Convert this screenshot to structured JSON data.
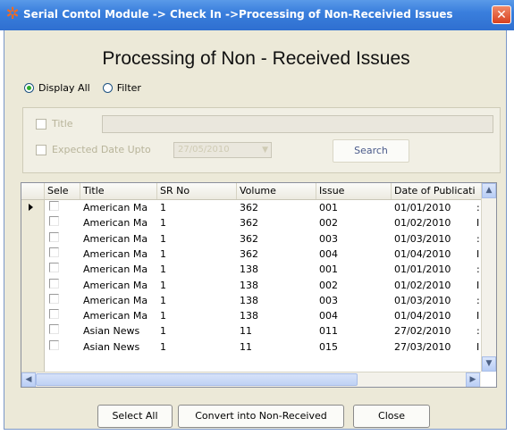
{
  "window": {
    "title": "Serial Contol Module -> Check In ->Processing of Non-Receivied Issues",
    "close_glyph": "✕",
    "app_icon": "module-icon"
  },
  "heading": "Processing of Non - Received Issues",
  "view_mode": {
    "options": [
      "Display All",
      "Filter"
    ],
    "selected": "Display All"
  },
  "filter": {
    "title_label": "Title",
    "title_value": "",
    "date_label": "Expected Date Upto",
    "date_value": "27/05/2010",
    "search_label": "Search"
  },
  "grid": {
    "columns": [
      "Sele",
      "Title",
      "SR No",
      "Volume",
      "Issue",
      "Date of Publicati"
    ],
    "rows": [
      {
        "title": "American Ma",
        "sr": "1",
        "volume": "362",
        "issue": "001",
        "date": "01/01/2010",
        "tail": ":"
      },
      {
        "title": "American Ma",
        "sr": "1",
        "volume": "362",
        "issue": "002",
        "date": "01/02/2010",
        "tail": "I"
      },
      {
        "title": "American Ma",
        "sr": "1",
        "volume": "362",
        "issue": "003",
        "date": "01/03/2010",
        "tail": ":"
      },
      {
        "title": "American Ma",
        "sr": "1",
        "volume": "362",
        "issue": "004",
        "date": "01/04/2010",
        "tail": "I"
      },
      {
        "title": "American Ma",
        "sr": "1",
        "volume": "138",
        "issue": "001",
        "date": "01/01/2010",
        "tail": ":"
      },
      {
        "title": "American Ma",
        "sr": "1",
        "volume": "138",
        "issue": "002",
        "date": "01/02/2010",
        "tail": "I"
      },
      {
        "title": "American Ma",
        "sr": "1",
        "volume": "138",
        "issue": "003",
        "date": "01/03/2010",
        "tail": ":"
      },
      {
        "title": "American Ma",
        "sr": "1",
        "volume": "138",
        "issue": "004",
        "date": "01/04/2010",
        "tail": "I"
      },
      {
        "title": "Asian News",
        "sr": "1",
        "volume": "11",
        "issue": "011",
        "date": "27/02/2010",
        "tail": ":"
      },
      {
        "title": "Asian News",
        "sr": "1",
        "volume": "11",
        "issue": "015",
        "date": "27/03/2010",
        "tail": "I"
      }
    ],
    "current_row_index": 0
  },
  "buttons": {
    "select_all": "Select All",
    "convert": "Convert into Non-Received",
    "close": "Close"
  },
  "colors": {
    "titlebar": "#3a7fdd",
    "window_bg": "#ece9d8",
    "close_button": "#d8401f",
    "radio_dot": "#2bab2b"
  }
}
